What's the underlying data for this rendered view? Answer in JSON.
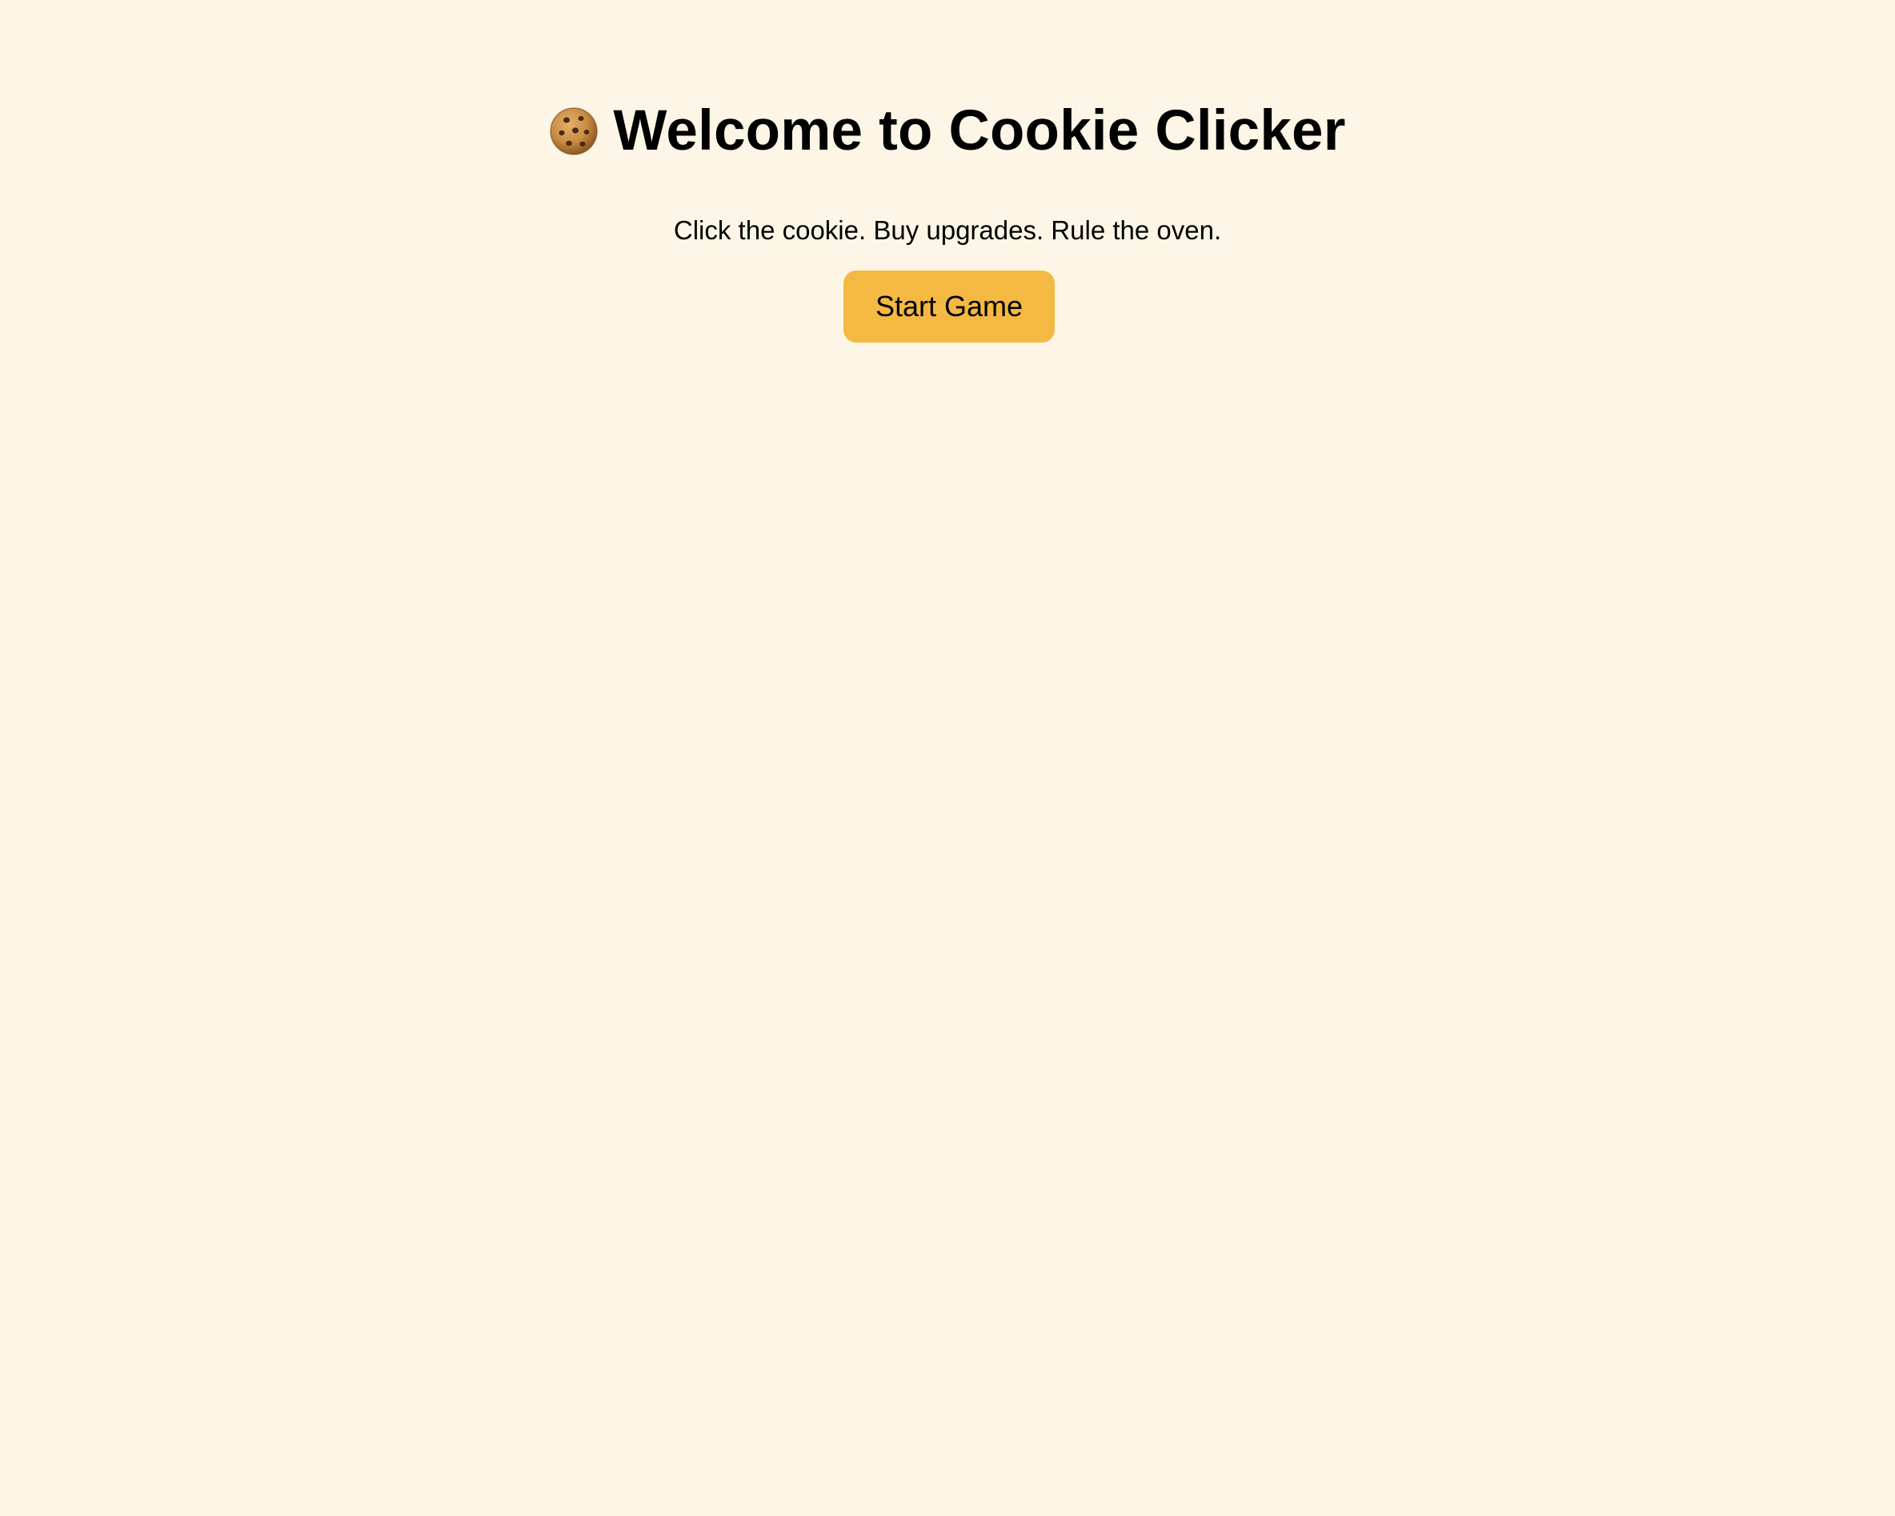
{
  "welcome": {
    "title": "Welcome to Cookie Clicker",
    "tagline": "Click the cookie. Buy upgrades. Rule the oven.",
    "start_label": "Start Game",
    "title_icon": "cookie-icon"
  },
  "colors": {
    "background": "#fdf6e6",
    "button": "#f4b942",
    "text": "#000000"
  }
}
